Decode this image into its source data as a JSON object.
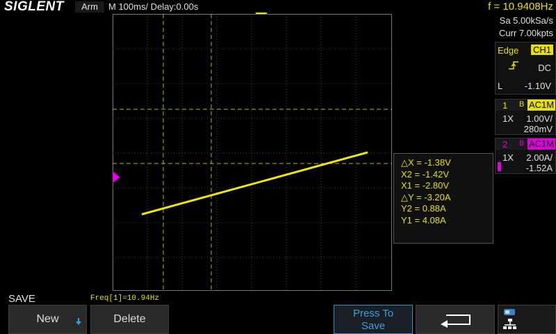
{
  "header": {
    "logo": "SIGLENT",
    "run_state": "Arm",
    "timebase": "M 100ms/  Delay:0.00s",
    "frequency": "f = 10.9408Hz"
  },
  "acquisition": {
    "sample_rate": "Sa 5.00kSa/s",
    "memory": "Curr 7.00kpts"
  },
  "trigger": {
    "type": "Edge",
    "source": "CH1",
    "coupling": "DC",
    "level_label": "L",
    "level": "-1.10V"
  },
  "channels": [
    {
      "number": "1",
      "bw": "B",
      "coupling": "AC1M",
      "probe": "1X",
      "scale": "1.00V/",
      "offset": "280mV",
      "color": "#e8e000"
    },
    {
      "number": "2",
      "bw": "B",
      "coupling": "AC1M",
      "probe": "1X",
      "scale": "2.00A/",
      "offset": "-1.52A",
      "color": "#e000e0"
    }
  ],
  "cursors": {
    "dx": "△X = -1.38V",
    "x2": "X2 = -1.42V",
    "x1": "X1 = -2.80V",
    "dy": "△Y = -3.20A",
    "y2": "Y2 = 0.88A",
    "y1": "Y1 = 4.08A"
  },
  "bottom": {
    "menu_title": "SAVE",
    "freq_counter": "Freq[1]=10.94Hz",
    "new_label": "New",
    "delete_label": "Delete",
    "press_to_save_line1": "Press To",
    "press_to_save_line2": "Save"
  },
  "colors": {
    "ch1": "#e8e000",
    "ch2": "#e000e0",
    "accent": "#3aa0e0"
  },
  "icons": {
    "trigger_slope": "rising-edge-icon",
    "back": "return-arrow-icon",
    "network": "network-icon"
  }
}
